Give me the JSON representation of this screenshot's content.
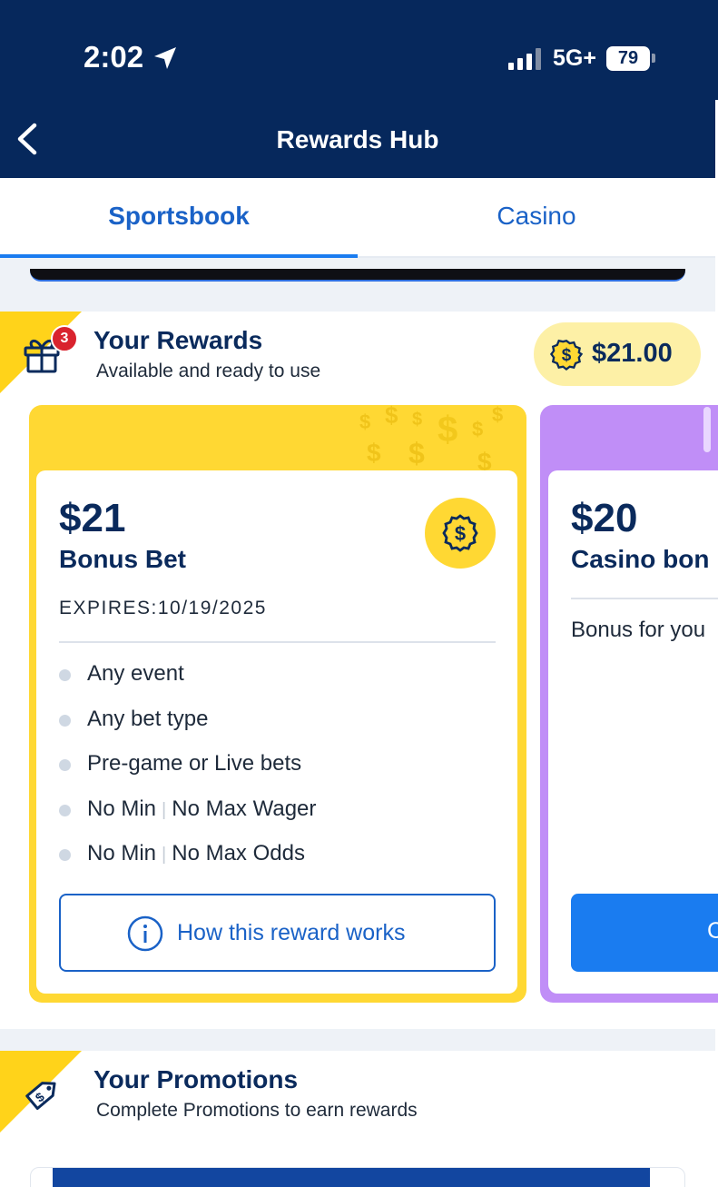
{
  "status_bar": {
    "time": "2:02",
    "network": "5G+",
    "battery": "79"
  },
  "nav": {
    "title": "Rewards Hub"
  },
  "tabs": [
    {
      "label": "Sportsbook",
      "active": true
    },
    {
      "label": "Casino",
      "active": false
    }
  ],
  "rewards": {
    "title": "Your Rewards",
    "subtitle": "Available and ready to use",
    "badge_count": "3",
    "balance": "$21.00",
    "cards": [
      {
        "amount": "$21",
        "type": "Bonus Bet",
        "expires": "EXPIRES:10/19/2025",
        "features": [
          {
            "a": "Any event"
          },
          {
            "a": "Any bet type"
          },
          {
            "a": "Pre-game or Live bets"
          },
          {
            "a": "No Min",
            "sep": "|",
            "b": "No Max Wager"
          },
          {
            "a": "No Min",
            "sep": "|",
            "b": "No Max Odds"
          }
        ],
        "button": "How this reward works"
      },
      {
        "amount": "$20",
        "type": "Casino bon",
        "description": "Bonus for you",
        "button": "C"
      }
    ]
  },
  "promotions": {
    "title": "Your Promotions",
    "subtitle": "Complete Promotions to earn rewards"
  },
  "colors": {
    "navy": "#06285c",
    "accent_blue": "#1a7cf0",
    "reward_yellow": "#ffd833",
    "casino_purple": "#c08ef7",
    "badge_red": "#d9232e"
  },
  "icons": [
    "location-arrow-icon",
    "signal-icon",
    "battery-icon",
    "back-chevron-icon",
    "gift-icon",
    "dollar-coin-icon",
    "info-icon",
    "price-tag-icon"
  ]
}
